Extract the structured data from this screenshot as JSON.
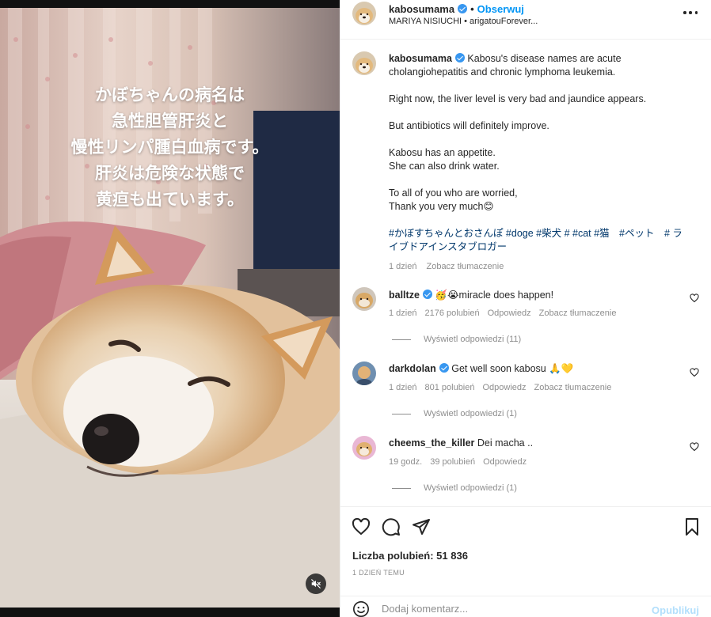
{
  "media": {
    "overlay_lines": [
      "かぼちゃんの病名は",
      "急性胆管肝炎と",
      "慢性リンパ腫白血病です。",
      "肝炎は危険な状態で",
      "黄疸も出ています。"
    ],
    "mute_icon": "speaker-muted-icon"
  },
  "header": {
    "username": "kabosumama",
    "follow_label": "Obserwuj",
    "subtitle": "MARIYA NISIUCHI • arigatouForever...",
    "more_icon": "more-options-icon"
  },
  "caption": {
    "username": "kabosumama",
    "first_line": "Kabosu's disease names are acute cholangiohepatitis and chronic lymphoma leukemia.",
    "p2": "Right now, the liver level is very bad and jaundice appears.",
    "p3": "But antibiotics will definitely improve.",
    "p4a": "Kabosu has an appetite.",
    "p4b": "She can also drink water.",
    "p5a": "To all of you who are worried,",
    "p5b": "Thank you very much😊",
    "hashtags": "#かぼすちゃんとおさんぽ #doge #柴犬 # #cat #猫　#ペット　# ライブドアインスタブロガー",
    "time": "1 dzień",
    "translate": "Zobacz tłumaczenie"
  },
  "comments": [
    {
      "username": "balltze",
      "text": "🥳😭miracle does happen!",
      "time": "1 dzień",
      "likes": "2176 polubień",
      "reply": "Odpowiedz",
      "translate": "Zobacz tłumaczenie",
      "view_replies": "Wyświetl odpowiedzi (11)"
    },
    {
      "username": "darkdolan",
      "text": "Get well soon kabosu 🙏💛",
      "time": "1 dzień",
      "likes": "801 polubień",
      "reply": "Odpowiedz",
      "translate": "Zobacz tłumaczenie",
      "view_replies": "Wyświetl odpowiedzi (1)"
    },
    {
      "username": "cheems_the_killer",
      "text": "Dei macha ..",
      "time": "19 godz.",
      "likes": "39 polubień",
      "reply": "Odpowiedz",
      "view_replies": "Wyświetl odpowiedzi (1)"
    }
  ],
  "actions": {
    "like_icon": "heart-icon",
    "comment_icon": "comment-icon",
    "share_icon": "share-icon",
    "save_icon": "bookmark-icon",
    "likes_text": "Liczba polubień: 51 836",
    "ago": "1 DZIEŃ TEMU"
  },
  "add_comment": {
    "emoji_icon": "emoji-icon",
    "placeholder": "Dodaj komentarz...",
    "publish_label": "Opublikuj"
  },
  "colors": {
    "link_blue": "#0095f6",
    "hashtag": "#00376b",
    "secondary_text": "#8e8e8e",
    "publish_disabled": "#b2dffc"
  }
}
